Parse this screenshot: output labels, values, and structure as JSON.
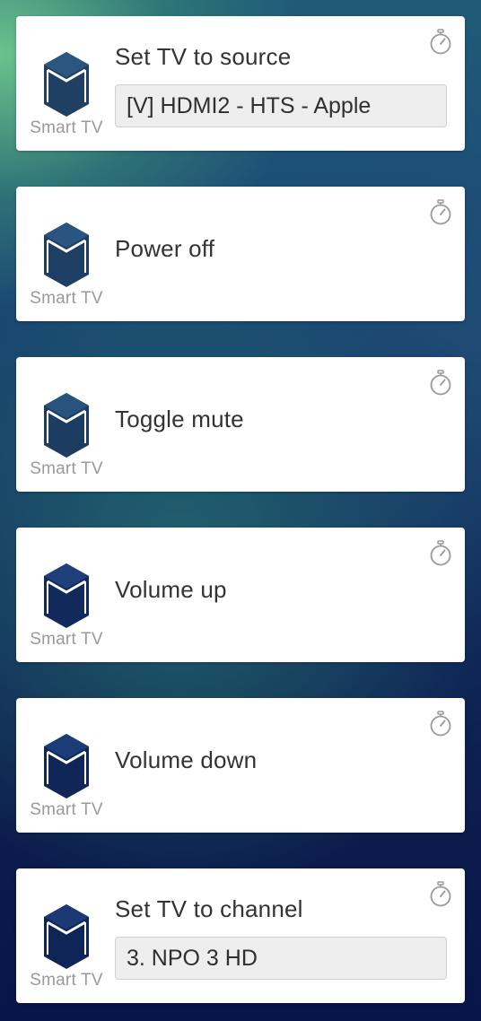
{
  "cards": [
    {
      "title": "Set TV to source",
      "device_label": "Smart TV",
      "field_value": "[V] HDMI2 - HTS - Apple",
      "icon_color": "#1f3f63"
    },
    {
      "title": "Power off",
      "device_label": "Smart TV",
      "icon_color": "#1e3e63"
    },
    {
      "title": "Toggle mute",
      "device_label": "Smart TV",
      "icon_color": "#1d3c62"
    },
    {
      "title": "Volume up",
      "device_label": "Smart TV",
      "icon_color": "#12295c"
    },
    {
      "title": "Volume down",
      "device_label": "Smart TV",
      "icon_color": "#102659"
    },
    {
      "title": "Set TV to channel",
      "device_label": "Smart TV",
      "field_value": "3. NPO 3 HD",
      "icon_color": "#0f2457"
    }
  ],
  "icons": {
    "device": "smart-tv-cube-icon",
    "timer": "stopwatch-icon"
  }
}
